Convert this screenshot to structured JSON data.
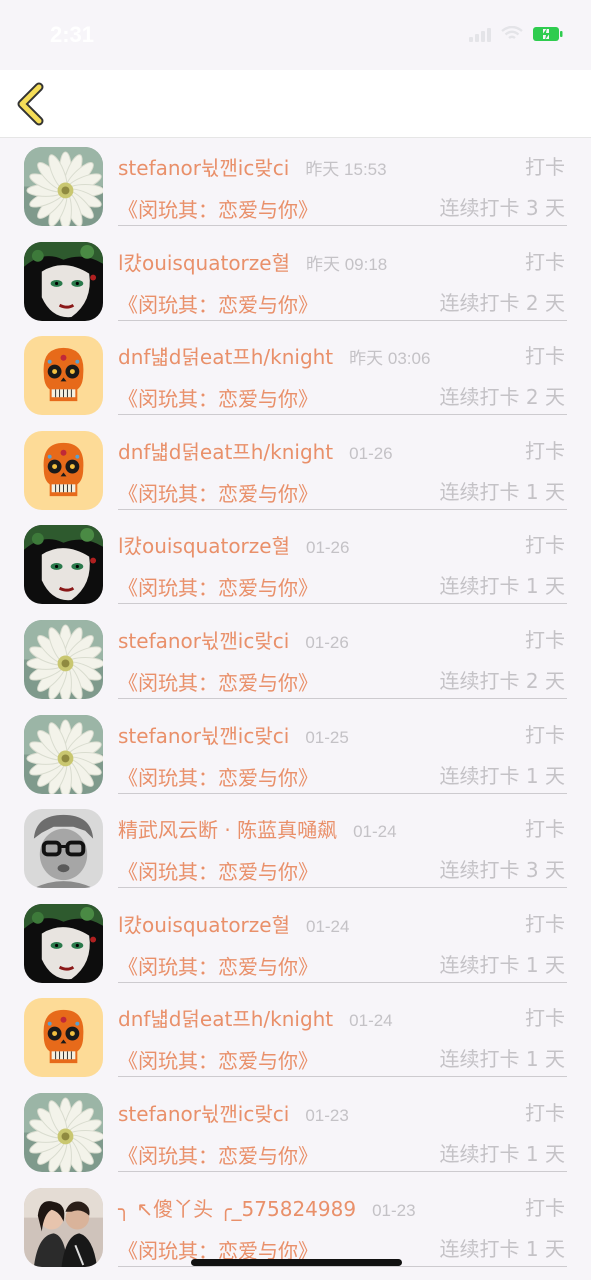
{
  "status": {
    "time": "2:31"
  },
  "header": {
    "back_icon": "chevron-left-icon",
    "accent": "#f5dd57"
  },
  "colors": {
    "name": "#e9906a",
    "muted": "#c4c2c6"
  },
  "records": [
    {
      "name": "stefanor뉛깬ic랒ci",
      "time": "昨天 15:53",
      "action": "打卡",
      "book": "《闵玧其：恋爱与你》",
      "streak": "连续打卡 3 天",
      "avatar": "daisy"
    },
    {
      "name": "l컀ouisquatorze혈",
      "time": "昨天 09:18",
      "action": "打卡",
      "book": "《闵玧其：恋爱与你》",
      "streak": "连续打卡 2 天",
      "avatar": "face"
    },
    {
      "name": "dnf냷d덝eat프h/knight",
      "time": "昨天 03:06",
      "action": "打卡",
      "book": "《闵玧其：恋爱与你》",
      "streak": "连续打卡 2 天",
      "avatar": "skull"
    },
    {
      "name": "dnf냷d덝eat프h/knight",
      "time": "01-26",
      "action": "打卡",
      "book": "《闵玧其：恋爱与你》",
      "streak": "连续打卡 1 天",
      "avatar": "skull"
    },
    {
      "name": "l컀ouisquatorze혈",
      "time": "01-26",
      "action": "打卡",
      "book": "《闵玧其：恋爱与你》",
      "streak": "连续打卡 1 天",
      "avatar": "face"
    },
    {
      "name": "stefanor뉛깬ic랒ci",
      "time": "01-26",
      "action": "打卡",
      "book": "《闵玧其：恋爱与你》",
      "streak": "连续打卡 2 天",
      "avatar": "daisy"
    },
    {
      "name": "stefanor뉛깬ic랒ci",
      "time": "01-25",
      "action": "打卡",
      "book": "《闵玧其：恋爱与你》",
      "streak": "连续打卡 1 天",
      "avatar": "daisy"
    },
    {
      "name": "精武风云断 · 陈蓝真嗵飙",
      "time": "01-24",
      "action": "打卡",
      "book": "《闵玧其：恋爱与你》",
      "streak": "连续打卡 3 天",
      "avatar": "child"
    },
    {
      "name": "l컀ouisquatorze혈",
      "time": "01-24",
      "action": "打卡",
      "book": "《闵玧其：恋爱与你》",
      "streak": "连续打卡 1 天",
      "avatar": "face"
    },
    {
      "name": "dnf냷d덝eat프h/knight",
      "time": "01-24",
      "action": "打卡",
      "book": "《闵玧其：恋爱与你》",
      "streak": "连续打卡 1 天",
      "avatar": "skull"
    },
    {
      "name": "stefanor뉛깬ic랒ci",
      "time": "01-23",
      "action": "打卡",
      "book": "《闵玧其：恋爱与你》",
      "streak": "连续打卡 1 天",
      "avatar": "daisy"
    },
    {
      "name": "╮ ↖傻丫头 ╭_575824989",
      "time": "01-23",
      "action": "打卡",
      "book": "《闵玧其：恋爱与你》",
      "streak": "连续打卡 1 天",
      "avatar": "couple"
    }
  ]
}
